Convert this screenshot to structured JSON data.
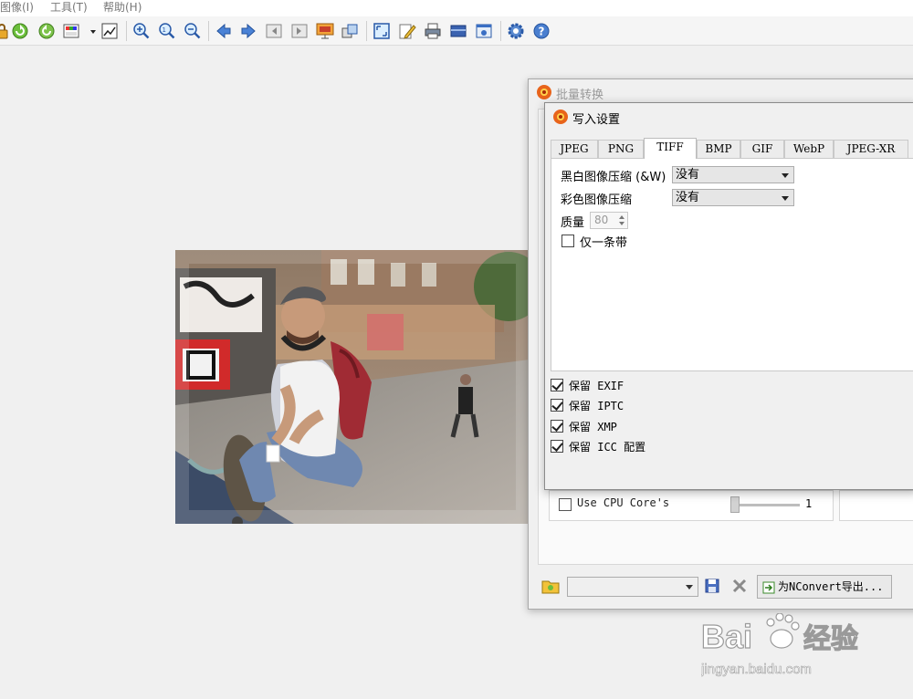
{
  "menu": {
    "items": [
      "图像(I)",
      "工具(T)",
      "帮助(H)"
    ]
  },
  "toolbar": {
    "icons": [
      "lock-icon",
      "refresh-icon",
      "rotate-icon",
      "palette-icon",
      "chart-icon",
      "zoom-in-icon",
      "zoom-fit-icon",
      "zoom-out-icon",
      "arrow-left-icon",
      "arrow-right-icon",
      "first-page-icon",
      "last-page-icon",
      "slideshow-icon",
      "capture-icon",
      "fullscreen-icon",
      "edit-icon",
      "print-icon",
      "scanner-icon",
      "screenshot-icon",
      "settings-icon",
      "help-icon"
    ]
  },
  "batch_window": {
    "title": "批量转换",
    "cpu_label": "Use CPU Core's",
    "cpu_value": "1",
    "combo_value": "",
    "export_button": "为NConvert导出..."
  },
  "write_dialog": {
    "title": "写入设置",
    "tabs": [
      "JPEG",
      "PNG",
      "TIFF",
      "BMP",
      "GIF",
      "WebP",
      "JPEG-XR"
    ],
    "active_tab": "TIFF",
    "bw_compression_label": "黑白图像压缩 (&W)",
    "bw_compression_value": "没有",
    "color_compression_label": "彩色图像压缩",
    "color_compression_value": "没有",
    "quality_label": "质量",
    "quality_value": "80",
    "single_strip_label": "仅一条带",
    "keep_exif": "保留 EXIF",
    "keep_iptc": "保留 IPTC",
    "keep_xmp": "保留 XMP",
    "keep_icc": "保留 ICC 配置"
  },
  "colors": {
    "accent_orange": "#e8641b",
    "toolbar_blue": "#3a6fc4",
    "background": "#f0f0f0"
  }
}
